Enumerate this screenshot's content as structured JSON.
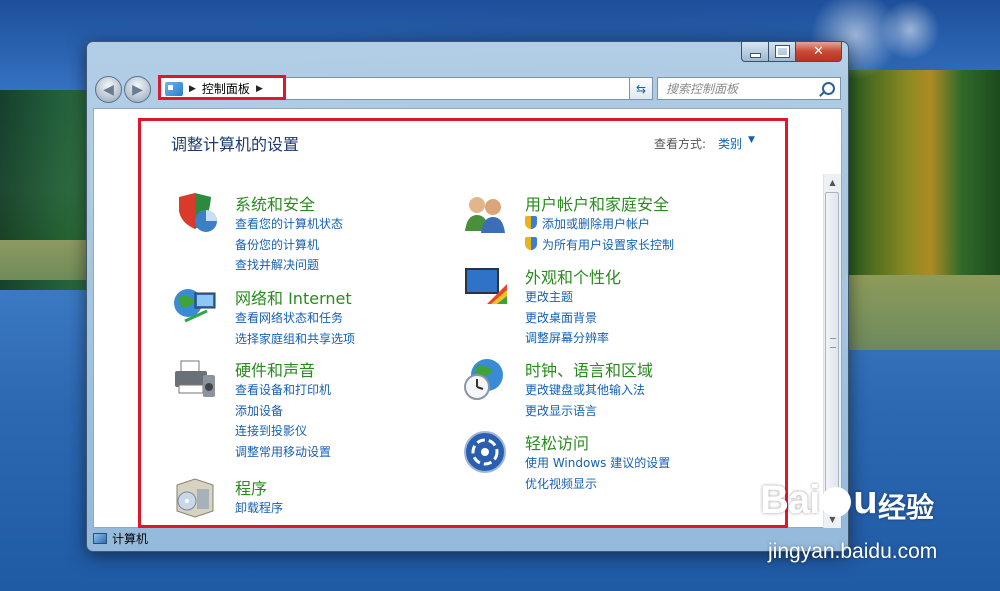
{
  "window": {
    "address": {
      "root_label": "控制面板"
    },
    "search": {
      "placeholder": "搜索控制面板"
    },
    "content": {
      "title": "调整计算机的设置",
      "view_by_label": "查看方式:",
      "view_by_value": "类别",
      "categories": [
        {
          "title": "系统和安全",
          "links": [
            "查看您的计算机状态",
            "备份您的计算机",
            "查找并解决问题"
          ]
        },
        {
          "title": "网络和 Internet",
          "links": [
            "查看网络状态和任务",
            "选择家庭组和共享选项"
          ]
        },
        {
          "title": "硬件和声音",
          "links": [
            "查看设备和打印机",
            "添加设备",
            "连接到投影仪",
            "调整常用移动设置"
          ]
        },
        {
          "title": "程序",
          "links": [
            "卸载程序"
          ]
        },
        {
          "title": "用户帐户和家庭安全",
          "links": [
            "添加或删除用户帐户",
            "为所有用户设置家长控制"
          ]
        },
        {
          "title": "外观和个性化",
          "links": [
            "更改主题",
            "更改桌面背景",
            "调整屏幕分辨率"
          ]
        },
        {
          "title": "时钟、语言和区域",
          "links": [
            "更改键盘或其他输入法",
            "更改显示语言"
          ]
        },
        {
          "title": "轻松访问",
          "links": [
            "使用 Windows 建议的设置",
            "优化视频显示"
          ]
        }
      ]
    },
    "statusbar": {
      "label": "计算机"
    }
  },
  "watermark": {
    "logo_left": "Bai",
    "logo_right": "u",
    "chinese": "经验",
    "url": "jingyan.baidu.com"
  },
  "icons": [
    "back-arrow-icon",
    "forward-arrow-icon",
    "control-panel-icon",
    "refresh-icon",
    "search-icon",
    "shield-icon",
    "computer-icon"
  ],
  "colors": {
    "category_title": "#2a8a1f",
    "link": "#1560b5",
    "highlight": "#e0162b"
  }
}
